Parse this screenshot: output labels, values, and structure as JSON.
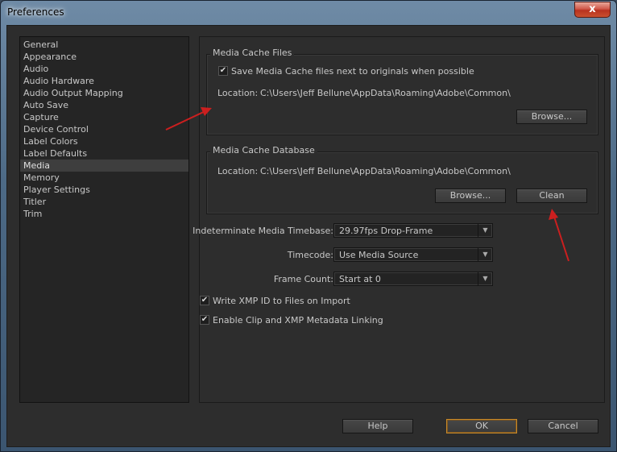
{
  "window": {
    "title": "Preferences",
    "close_glyph": "x"
  },
  "categories": [
    {
      "label": "General"
    },
    {
      "label": "Appearance"
    },
    {
      "label": "Audio"
    },
    {
      "label": "Audio Hardware"
    },
    {
      "label": "Audio Output Mapping"
    },
    {
      "label": "Auto Save"
    },
    {
      "label": "Capture"
    },
    {
      "label": "Device Control"
    },
    {
      "label": "Label Colors"
    },
    {
      "label": "Label Defaults"
    },
    {
      "label": "Media"
    },
    {
      "label": "Memory"
    },
    {
      "label": "Player Settings"
    },
    {
      "label": "Titler"
    },
    {
      "label": "Trim"
    }
  ],
  "selected_category": "Media",
  "media_cache_files": {
    "title": "Media Cache Files",
    "save_next_to_originals_label": "Save Media Cache files next to originals when possible",
    "save_next_to_originals_checked": true,
    "location_label": "Location:",
    "location_value": "C:\\Users\\Jeff Bellune\\AppData\\Roaming\\Adobe\\Common\\",
    "browse_label": "Browse..."
  },
  "media_cache_database": {
    "title": "Media Cache Database",
    "location_label": "Location:",
    "location_value": "C:\\Users\\Jeff Bellune\\AppData\\Roaming\\Adobe\\Common\\",
    "browse_label": "Browse...",
    "clean_label": "Clean"
  },
  "settings": {
    "timebase_label": "Indeterminate Media Timebase:",
    "timebase_value": "29.97fps Drop-Frame",
    "timecode_label": "Timecode:",
    "timecode_value": "Use Media Source",
    "frame_count_label": "Frame Count:",
    "frame_count_value": "Start at 0",
    "write_xmp_label": "Write XMP ID to Files on Import",
    "write_xmp_checked": true,
    "enable_linking_label": "Enable Clip and XMP Metadata Linking",
    "enable_linking_checked": true
  },
  "footer": {
    "help_label": "Help",
    "ok_label": "OK",
    "cancel_label": "Cancel"
  },
  "annotation_arrow_color": "#cc1f1f",
  "check_glyph": "✔",
  "dropdown_arrow_glyph": "▼"
}
